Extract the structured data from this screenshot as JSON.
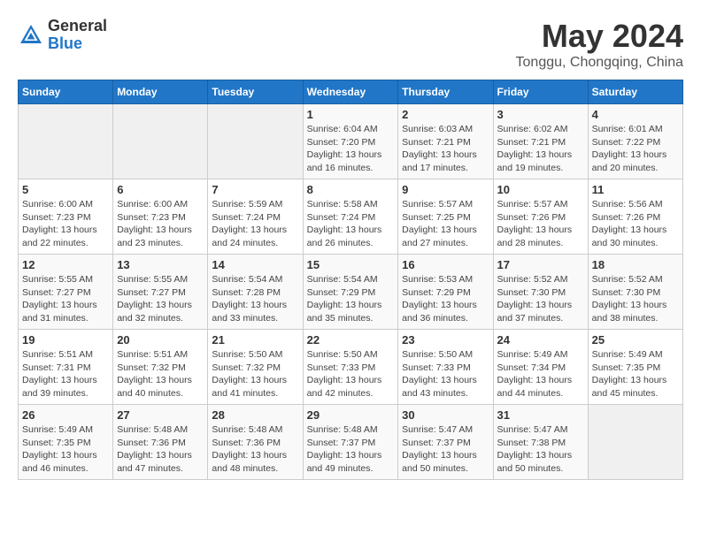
{
  "header": {
    "logo_line1": "General",
    "logo_line2": "Blue",
    "title": "May 2024",
    "subtitle": "Tonggu, Chongqing, China"
  },
  "weekdays": [
    "Sunday",
    "Monday",
    "Tuesday",
    "Wednesday",
    "Thursday",
    "Friday",
    "Saturday"
  ],
  "weeks": [
    [
      {
        "day": "",
        "info": ""
      },
      {
        "day": "",
        "info": ""
      },
      {
        "day": "",
        "info": ""
      },
      {
        "day": "1",
        "info": "Sunrise: 6:04 AM\nSunset: 7:20 PM\nDaylight: 13 hours\nand 16 minutes."
      },
      {
        "day": "2",
        "info": "Sunrise: 6:03 AM\nSunset: 7:21 PM\nDaylight: 13 hours\nand 17 minutes."
      },
      {
        "day": "3",
        "info": "Sunrise: 6:02 AM\nSunset: 7:21 PM\nDaylight: 13 hours\nand 19 minutes."
      },
      {
        "day": "4",
        "info": "Sunrise: 6:01 AM\nSunset: 7:22 PM\nDaylight: 13 hours\nand 20 minutes."
      }
    ],
    [
      {
        "day": "5",
        "info": "Sunrise: 6:00 AM\nSunset: 7:23 PM\nDaylight: 13 hours\nand 22 minutes."
      },
      {
        "day": "6",
        "info": "Sunrise: 6:00 AM\nSunset: 7:23 PM\nDaylight: 13 hours\nand 23 minutes."
      },
      {
        "day": "7",
        "info": "Sunrise: 5:59 AM\nSunset: 7:24 PM\nDaylight: 13 hours\nand 24 minutes."
      },
      {
        "day": "8",
        "info": "Sunrise: 5:58 AM\nSunset: 7:24 PM\nDaylight: 13 hours\nand 26 minutes."
      },
      {
        "day": "9",
        "info": "Sunrise: 5:57 AM\nSunset: 7:25 PM\nDaylight: 13 hours\nand 27 minutes."
      },
      {
        "day": "10",
        "info": "Sunrise: 5:57 AM\nSunset: 7:26 PM\nDaylight: 13 hours\nand 28 minutes."
      },
      {
        "day": "11",
        "info": "Sunrise: 5:56 AM\nSunset: 7:26 PM\nDaylight: 13 hours\nand 30 minutes."
      }
    ],
    [
      {
        "day": "12",
        "info": "Sunrise: 5:55 AM\nSunset: 7:27 PM\nDaylight: 13 hours\nand 31 minutes."
      },
      {
        "day": "13",
        "info": "Sunrise: 5:55 AM\nSunset: 7:27 PM\nDaylight: 13 hours\nand 32 minutes."
      },
      {
        "day": "14",
        "info": "Sunrise: 5:54 AM\nSunset: 7:28 PM\nDaylight: 13 hours\nand 33 minutes."
      },
      {
        "day": "15",
        "info": "Sunrise: 5:54 AM\nSunset: 7:29 PM\nDaylight: 13 hours\nand 35 minutes."
      },
      {
        "day": "16",
        "info": "Sunrise: 5:53 AM\nSunset: 7:29 PM\nDaylight: 13 hours\nand 36 minutes."
      },
      {
        "day": "17",
        "info": "Sunrise: 5:52 AM\nSunset: 7:30 PM\nDaylight: 13 hours\nand 37 minutes."
      },
      {
        "day": "18",
        "info": "Sunrise: 5:52 AM\nSunset: 7:30 PM\nDaylight: 13 hours\nand 38 minutes."
      }
    ],
    [
      {
        "day": "19",
        "info": "Sunrise: 5:51 AM\nSunset: 7:31 PM\nDaylight: 13 hours\nand 39 minutes."
      },
      {
        "day": "20",
        "info": "Sunrise: 5:51 AM\nSunset: 7:32 PM\nDaylight: 13 hours\nand 40 minutes."
      },
      {
        "day": "21",
        "info": "Sunrise: 5:50 AM\nSunset: 7:32 PM\nDaylight: 13 hours\nand 41 minutes."
      },
      {
        "day": "22",
        "info": "Sunrise: 5:50 AM\nSunset: 7:33 PM\nDaylight: 13 hours\nand 42 minutes."
      },
      {
        "day": "23",
        "info": "Sunrise: 5:50 AM\nSunset: 7:33 PM\nDaylight: 13 hours\nand 43 minutes."
      },
      {
        "day": "24",
        "info": "Sunrise: 5:49 AM\nSunset: 7:34 PM\nDaylight: 13 hours\nand 44 minutes."
      },
      {
        "day": "25",
        "info": "Sunrise: 5:49 AM\nSunset: 7:35 PM\nDaylight: 13 hours\nand 45 minutes."
      }
    ],
    [
      {
        "day": "26",
        "info": "Sunrise: 5:49 AM\nSunset: 7:35 PM\nDaylight: 13 hours\nand 46 minutes."
      },
      {
        "day": "27",
        "info": "Sunrise: 5:48 AM\nSunset: 7:36 PM\nDaylight: 13 hours\nand 47 minutes."
      },
      {
        "day": "28",
        "info": "Sunrise: 5:48 AM\nSunset: 7:36 PM\nDaylight: 13 hours\nand 48 minutes."
      },
      {
        "day": "29",
        "info": "Sunrise: 5:48 AM\nSunset: 7:37 PM\nDaylight: 13 hours\nand 49 minutes."
      },
      {
        "day": "30",
        "info": "Sunrise: 5:47 AM\nSunset: 7:37 PM\nDaylight: 13 hours\nand 50 minutes."
      },
      {
        "day": "31",
        "info": "Sunrise: 5:47 AM\nSunset: 7:38 PM\nDaylight: 13 hours\nand 50 minutes."
      },
      {
        "day": "",
        "info": ""
      }
    ]
  ]
}
